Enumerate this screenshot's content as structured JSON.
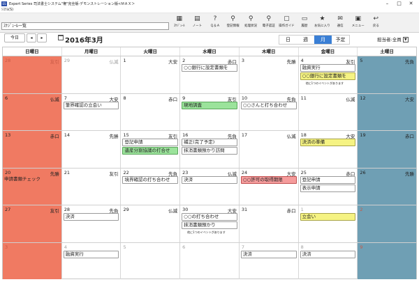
{
  "window": {
    "title": "Expert Series 司法書士システム\"権\"完全版-デモンストレーション版<ＭＡＸ＞",
    "app_icon": "ES"
  },
  "menu": {
    "label": "ｼｽﾃﾑ(S)"
  },
  "toolbar": {
    "title": "ｽｹｼﾞｭｰﾙ一覧",
    "buttons": [
      {
        "label": "ｽｹｼﾞｭｰﾙ",
        "icon": "calendar-icon",
        "glyph": "▦"
      },
      {
        "label": "ノート",
        "icon": "note-icon",
        "glyph": "▤"
      },
      {
        "label": "Ｑ＆Ａ",
        "icon": "qa-icon",
        "glyph": "?"
      },
      {
        "label": "登記情報",
        "icon": "registry-icon",
        "glyph": "⚲"
      },
      {
        "label": "処理状況",
        "icon": "status-icon",
        "glyph": "⚲"
      },
      {
        "label": "電子認証",
        "icon": "auth-icon",
        "glyph": "⚲"
      },
      {
        "label": "操作ガイド",
        "icon": "guide-icon",
        "glyph": "▢"
      },
      {
        "label": "履歴",
        "icon": "history-icon",
        "glyph": "▭"
      },
      {
        "label": "お気に入り",
        "icon": "favorite-icon",
        "glyph": "★"
      },
      {
        "label": "通信",
        "icon": "mail-icon",
        "glyph": "✉"
      },
      {
        "label": "メニュー",
        "icon": "menu-icon",
        "glyph": "▣"
      },
      {
        "label": "戻る",
        "icon": "back-icon",
        "glyph": "↩"
      }
    ]
  },
  "nav": {
    "today": "今日",
    "prev": "◂",
    "next": "▸",
    "month": "2016年3月",
    "views": [
      {
        "label": "日",
        "active": false
      },
      {
        "label": "週",
        "active": false
      },
      {
        "label": "月",
        "active": true
      },
      {
        "label": "予定",
        "active": false
      }
    ],
    "assignee_label": "担当者:",
    "assignee_value": "全員"
  },
  "calendar": {
    "weekdays": [
      "日曜日",
      "月曜日",
      "火曜日",
      "水曜日",
      "木曜日",
      "金曜日",
      "土曜日"
    ],
    "weeks": [
      [
        {
          "d": "28",
          "rk": "友引",
          "out": true,
          "events": []
        },
        {
          "d": "29",
          "rk": "仏滅",
          "out": true,
          "events": []
        },
        {
          "d": "1",
          "rk": "大安",
          "events": []
        },
        {
          "d": "2",
          "rk": "赤口",
          "events": [
            {
              "t": "○○銀行に設定書類を",
              "c": "white"
            }
          ]
        },
        {
          "d": "3",
          "rk": "先勝",
          "events": []
        },
        {
          "d": "4",
          "rk": "友引",
          "events": [
            {
              "t": "融資実行",
              "c": "white"
            },
            {
              "t": "○○銀行に設定書類を",
              "c": "yellow"
            }
          ],
          "more": "他に1つのイベントがあります"
        },
        {
          "d": "5",
          "rk": "先負",
          "events": []
        }
      ],
      [
        {
          "d": "6",
          "rk": "仏滅",
          "events": []
        },
        {
          "d": "7",
          "rk": "大安",
          "events": [
            {
              "t": "筆界確認の立会い",
              "c": "white"
            }
          ]
        },
        {
          "d": "8",
          "rk": "赤口",
          "events": []
        },
        {
          "d": "9",
          "rk": "友引",
          "events": [
            {
              "t": "現地調査",
              "c": "green"
            }
          ]
        },
        {
          "d": "10",
          "rk": "先負",
          "events": [
            {
              "t": "○○さんと打ち合わせ",
              "c": "white"
            }
          ]
        },
        {
          "d": "11",
          "rk": "仏滅",
          "events": []
        },
        {
          "d": "12",
          "rk": "大安",
          "events": []
        }
      ],
      [
        {
          "d": "13",
          "rk": "赤口",
          "events": []
        },
        {
          "d": "14",
          "rk": "先勝",
          "events": []
        },
        {
          "d": "15",
          "rk": "友引",
          "events": [
            {
              "t": "登記申請",
              "c": "white"
            },
            {
              "t": "遺産分割協議の打合せ",
              "c": "green"
            }
          ]
        },
        {
          "d": "16",
          "rk": "先負",
          "events": [
            {
              "t": "補正(完了予定)",
              "c": "white"
            },
            {
              "t": "抹消書類預かり訪問",
              "c": "white"
            }
          ]
        },
        {
          "d": "17",
          "rk": "仏滅",
          "events": []
        },
        {
          "d": "18",
          "rk": "大安",
          "events": [
            {
              "t": "決済の準備",
              "c": "yellow"
            }
          ]
        },
        {
          "d": "19",
          "rk": "赤口",
          "events": []
        }
      ],
      [
        {
          "d": "20",
          "rk": "先勝",
          "events": [
            {
              "t": "申請書類チェック",
              "c": "white"
            }
          ]
        },
        {
          "d": "21",
          "rk": "友引",
          "events": []
        },
        {
          "d": "22",
          "rk": "先負",
          "events": [
            {
              "t": "境界確認の打ち合わせ",
              "c": "white"
            }
          ]
        },
        {
          "d": "23",
          "rk": "仏滅",
          "events": [
            {
              "t": "決済",
              "c": "white"
            }
          ]
        },
        {
          "d": "24",
          "rk": "大安",
          "events": [
            {
              "t": "○○許可の取得期限",
              "c": "red"
            }
          ]
        },
        {
          "d": "25",
          "rk": "赤口",
          "events": [
            {
              "t": "登記申請",
              "c": "white"
            },
            {
              "t": "表示申請",
              "c": "white"
            }
          ]
        },
        {
          "d": "26",
          "rk": "先勝",
          "events": []
        }
      ],
      [
        {
          "d": "27",
          "rk": "友引",
          "events": []
        },
        {
          "d": "28",
          "rk": "先負",
          "events": [
            {
              "t": "決済",
              "c": "white"
            }
          ]
        },
        {
          "d": "29",
          "rk": "仏滅",
          "events": []
        },
        {
          "d": "30",
          "rk": "大安",
          "events": [
            {
              "t": "○○の打ち合わせ",
              "c": "white"
            },
            {
              "t": "抹消書類預かり",
              "c": "white"
            }
          ],
          "more": "他に1つのイベントがあります"
        },
        {
          "d": "31",
          "rk": "赤口",
          "events": []
        },
        {
          "d": "1",
          "rk": "",
          "out": true,
          "events": [
            {
              "t": "立会い",
              "c": "yellow"
            }
          ]
        },
        {
          "d": "2",
          "rk": "",
          "out": true,
          "events": []
        }
      ],
      [
        {
          "d": "3",
          "rk": "",
          "out": true,
          "events": []
        },
        {
          "d": "4",
          "rk": "",
          "out": true,
          "events": [
            {
              "t": "融資実行",
              "c": "white"
            }
          ]
        },
        {
          "d": "5",
          "rk": "",
          "out": true,
          "events": []
        },
        {
          "d": "6",
          "rk": "",
          "out": true,
          "events": []
        },
        {
          "d": "7",
          "rk": "",
          "out": true,
          "events": [
            {
              "t": "決済",
              "c": "white"
            }
          ]
        },
        {
          "d": "8",
          "rk": "",
          "out": true,
          "events": [
            {
              "t": "決済",
              "c": "white"
            }
          ]
        },
        {
          "d": "9",
          "rk": "",
          "out": true,
          "events": []
        }
      ]
    ]
  }
}
